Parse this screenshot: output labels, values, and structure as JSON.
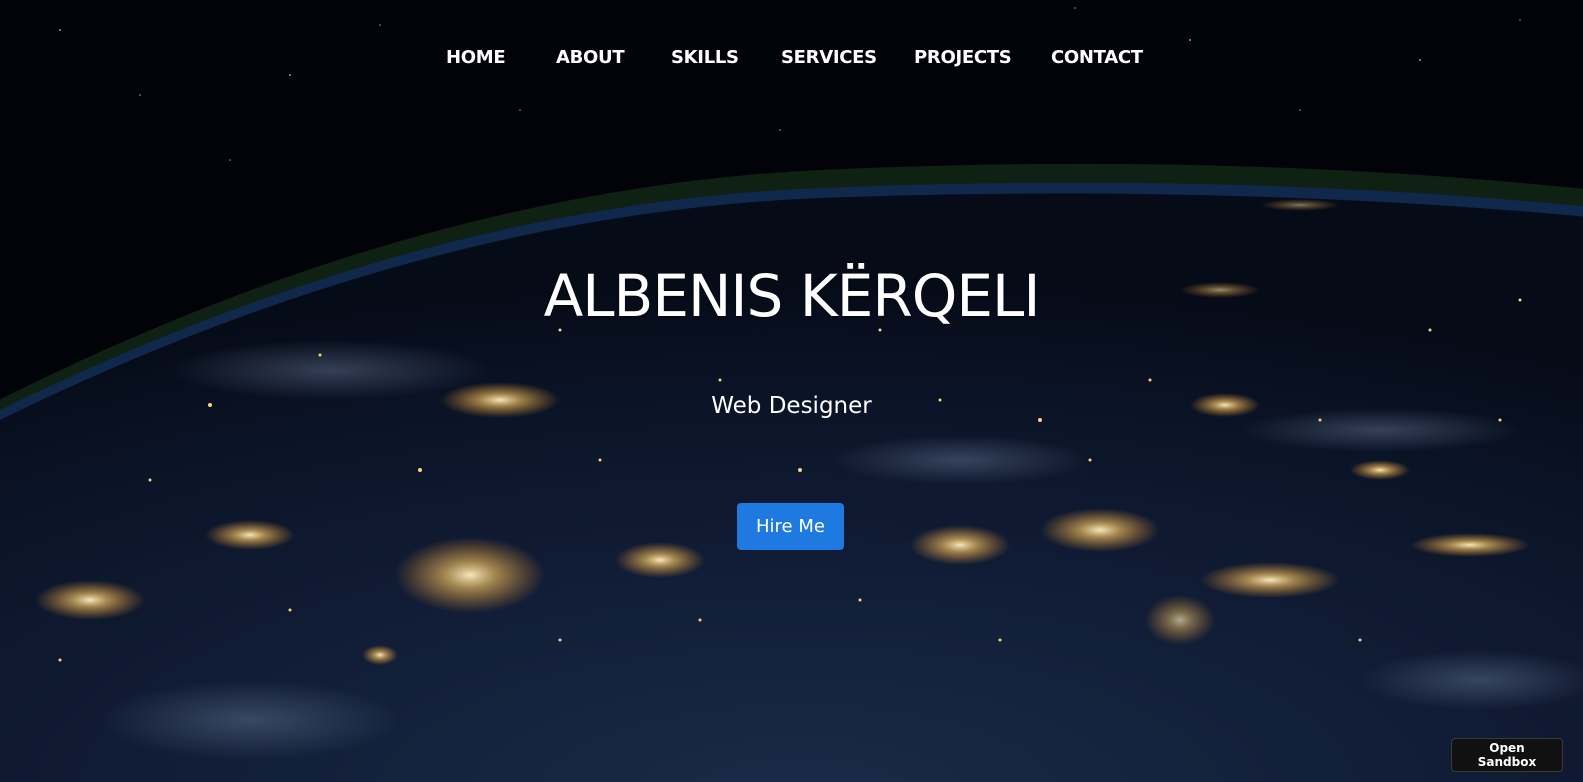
{
  "nav": {
    "items": [
      {
        "label": "HOME"
      },
      {
        "label": "ABOUT"
      },
      {
        "label": "SKILLS"
      },
      {
        "label": "SERVICES"
      },
      {
        "label": "PROJECTS"
      },
      {
        "label": "CONTACT"
      }
    ]
  },
  "hero": {
    "title": "ALBENIS KËRQELI",
    "subtitle": "Web Designer",
    "cta_label": "Hire Me",
    "background": "earth-at-night-from-space-photo"
  },
  "sandbox": {
    "label": "Open Sandbox"
  },
  "colors": {
    "accent": "#1e7ae0",
    "text": "#ffffff",
    "sky": "#02040a",
    "city_lights": "#ffd27a"
  }
}
